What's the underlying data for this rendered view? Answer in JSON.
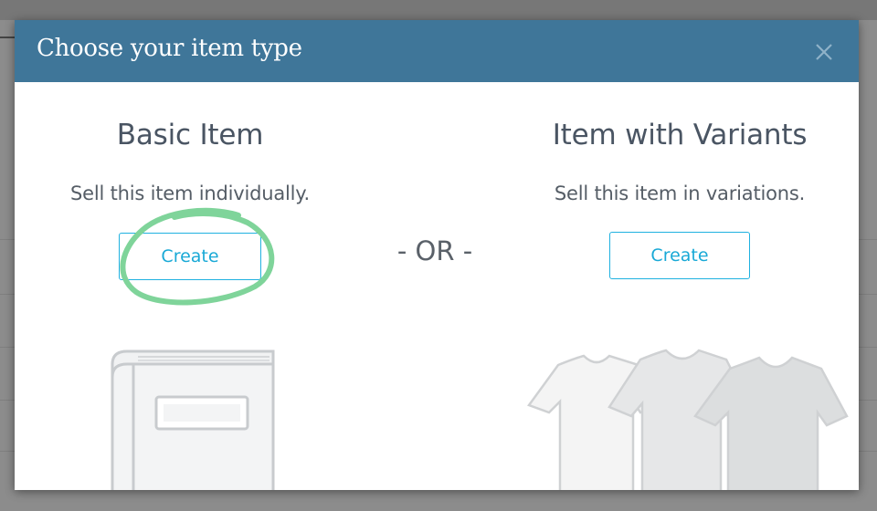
{
  "modal": {
    "title": "Choose your item type",
    "close_icon": "close-icon"
  },
  "options": {
    "basic": {
      "title": "Basic Item",
      "subtitle": "Sell this item individually.",
      "button_label": "Create",
      "illustration": "book-icon"
    },
    "separator": "- OR -",
    "variants": {
      "title": "Item with Variants",
      "subtitle": "Sell this item in variations.",
      "button_label": "Create",
      "illustration": "tshirts-icon"
    }
  },
  "colors": {
    "header": "#3f7699",
    "button_accent": "#1fb1e0",
    "highlight_circle": "#7fd49a"
  }
}
